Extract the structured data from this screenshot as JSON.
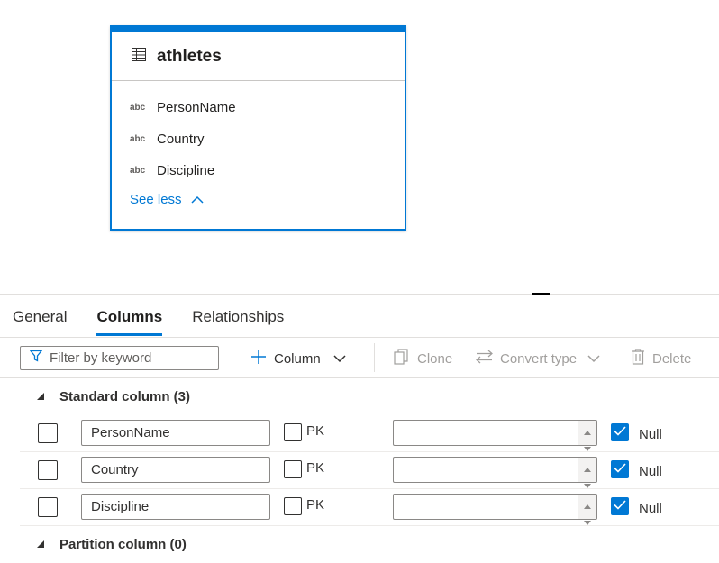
{
  "card": {
    "title": "athletes",
    "columns": [
      {
        "type": "abc",
        "name": "PersonName"
      },
      {
        "type": "abc",
        "name": "Country"
      },
      {
        "type": "abc",
        "name": "Discipline"
      }
    ],
    "see_less": "See less"
  },
  "tabs": [
    {
      "label": "General",
      "active": false
    },
    {
      "label": "Columns",
      "active": true
    },
    {
      "label": "Relationships",
      "active": false
    }
  ],
  "toolbar": {
    "filter_placeholder": "Filter by keyword",
    "add_column": "Column",
    "clone": "Clone",
    "convert_type": "Convert type",
    "delete": "Delete"
  },
  "groups": {
    "standard": "Standard column (3)",
    "partition": "Partition column (0)"
  },
  "rows": [
    {
      "name": "PersonName",
      "pk_label": "PK",
      "null_label": "Null",
      "null_checked": true
    },
    {
      "name": "Country",
      "pk_label": "PK",
      "null_label": "Null",
      "null_checked": true
    },
    {
      "name": "Discipline",
      "pk_label": "PK",
      "null_label": "Null",
      "null_checked": true
    }
  ],
  "colors": {
    "accent": "#0078d4"
  }
}
